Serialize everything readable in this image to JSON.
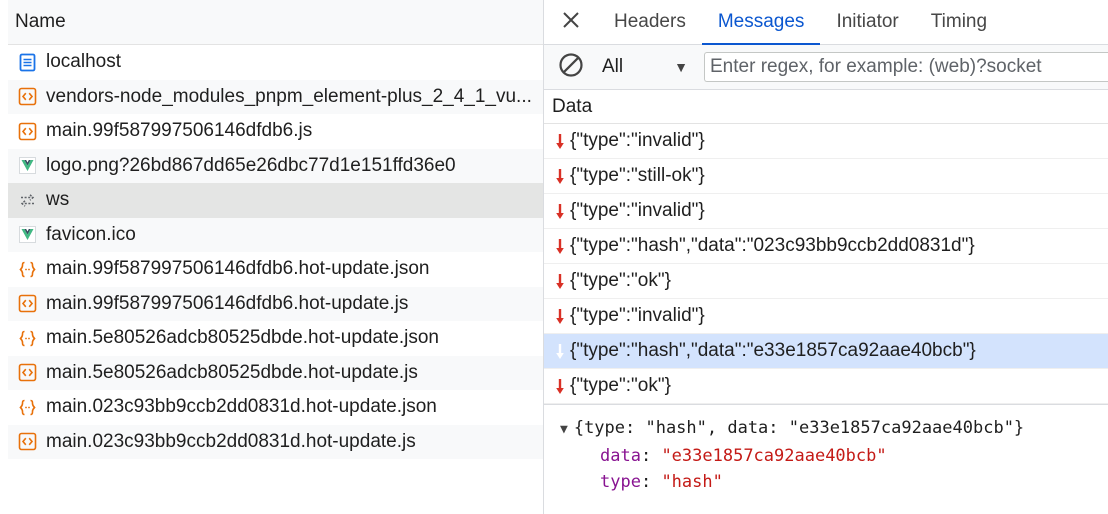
{
  "left": {
    "header": "Name",
    "requests": [
      {
        "name": "localhost",
        "icon": "document-icon"
      },
      {
        "name": "vendors-node_modules_pnpm_element-plus_2_4_1_vu...",
        "icon": "script-icon"
      },
      {
        "name": "main.99f587997506146dfdb6.js",
        "icon": "script-icon"
      },
      {
        "name": "logo.png?26bd867dd65e26dbc77d1e151ffd36e0",
        "icon": "image-icon"
      },
      {
        "name": "ws",
        "icon": "websocket-icon"
      },
      {
        "name": "favicon.ico",
        "icon": "image-icon"
      },
      {
        "name": "main.99f587997506146dfdb6.hot-update.json",
        "icon": "json-icon"
      },
      {
        "name": "main.99f587997506146dfdb6.hot-update.js",
        "icon": "script-icon"
      },
      {
        "name": "main.5e80526adcb80525dbde.hot-update.json",
        "icon": "json-icon"
      },
      {
        "name": "main.5e80526adcb80525dbde.hot-update.js",
        "icon": "script-icon"
      },
      {
        "name": "main.023c93bb9ccb2dd0831d.hot-update.json",
        "icon": "json-icon"
      },
      {
        "name": "main.023c93bb9ccb2dd0831d.hot-update.js",
        "icon": "script-icon"
      }
    ]
  },
  "tabs": {
    "items": [
      "Headers",
      "Messages",
      "Initiator",
      "Timing"
    ],
    "active": "Messages"
  },
  "filter": {
    "selected": "All",
    "placeholder": "Enter regex, for example: (web)?socket"
  },
  "messages": {
    "header": "Data",
    "rows": [
      "{\"type\":\"invalid\"}",
      "{\"type\":\"still-ok\"}",
      "{\"type\":\"invalid\"}",
      "{\"type\":\"hash\",\"data\":\"023c93bb9ccb2dd0831d\"}",
      "{\"type\":\"ok\"}",
      "{\"type\":\"invalid\"}",
      "{\"type\":\"hash\",\"data\":\"e33e1857ca92aae40bcb\"}",
      "{\"type\":\"ok\"}"
    ],
    "selected_index": 6
  },
  "preview": {
    "summary": "{type: \"hash\", data: \"e33e1857ca92aae40bcb\"}",
    "fields": [
      {
        "key": "data",
        "value": "\"e33e1857ca92aae40bcb\""
      },
      {
        "key": "type",
        "value": "\"hash\""
      }
    ]
  },
  "colors": {
    "accent": "#0b57d0",
    "received_arrow": "#d93025",
    "selected_row": "#d3e3fd",
    "selected_request": "#e4e5e4",
    "json_key": "#881391",
    "json_string": "#c41a16"
  }
}
